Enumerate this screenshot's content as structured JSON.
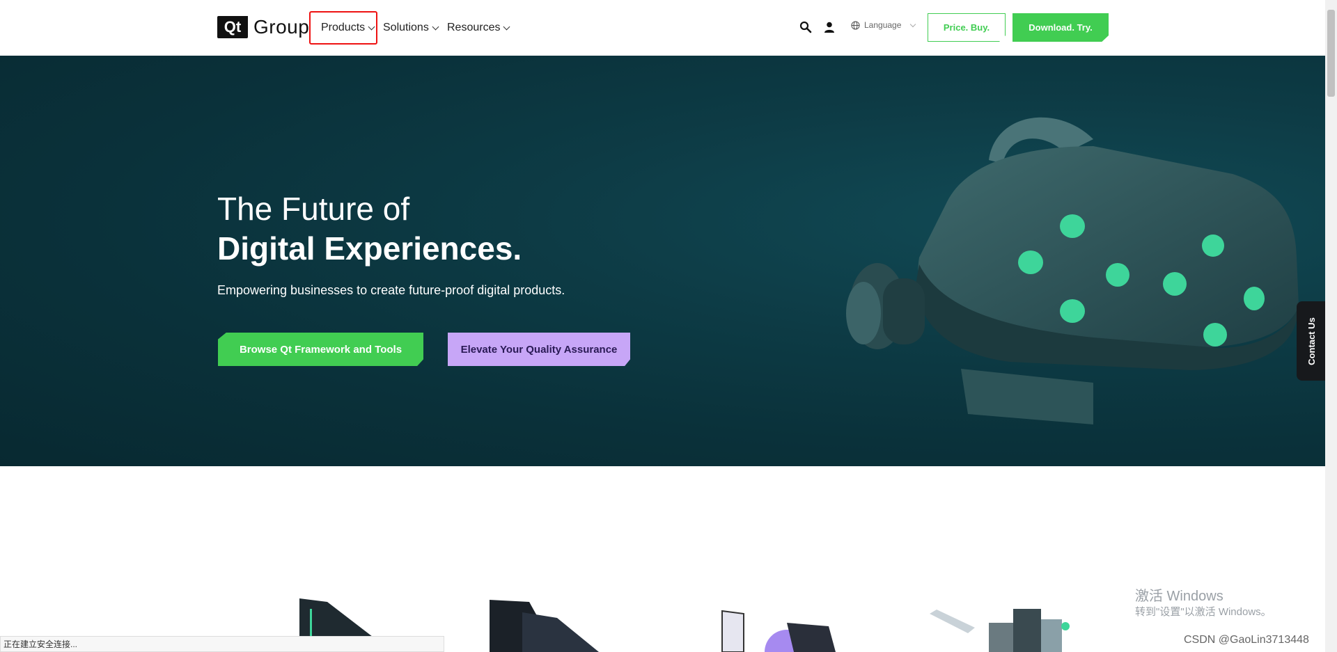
{
  "header": {
    "logo": {
      "mark": "Qt",
      "text": "Group"
    },
    "nav": [
      {
        "label": "Products"
      },
      {
        "label": "Solutions"
      },
      {
        "label": "Resources"
      }
    ],
    "icons": {
      "search": "search-icon",
      "account": "user-icon",
      "language": "globe-icon"
    },
    "language_label": "Language",
    "price_button": "Price. Buy.",
    "download_button": "Download. Try."
  },
  "hero": {
    "title_line1": "The Future of",
    "title_line2": "Digital Experiences.",
    "subtitle": "Empowering businesses to create future-proof digital products.",
    "primary_cta": "Browse Qt Framework and Tools",
    "secondary_cta": "Elevate Your Quality Assurance"
  },
  "contact_tab": "Contact Us",
  "watermark": {
    "line1": "激活 Windows",
    "line2": "转到\"设置\"以激活 Windows。"
  },
  "csdn_tag": "CSDN @GaoLin3713448",
  "status_bar": "正在建立安全连接...",
  "colors": {
    "brand_green": "#41cd52",
    "hero_bg": "#0d3b45",
    "lavender": "#c7a6f7",
    "highlight_red": "#e11111"
  }
}
